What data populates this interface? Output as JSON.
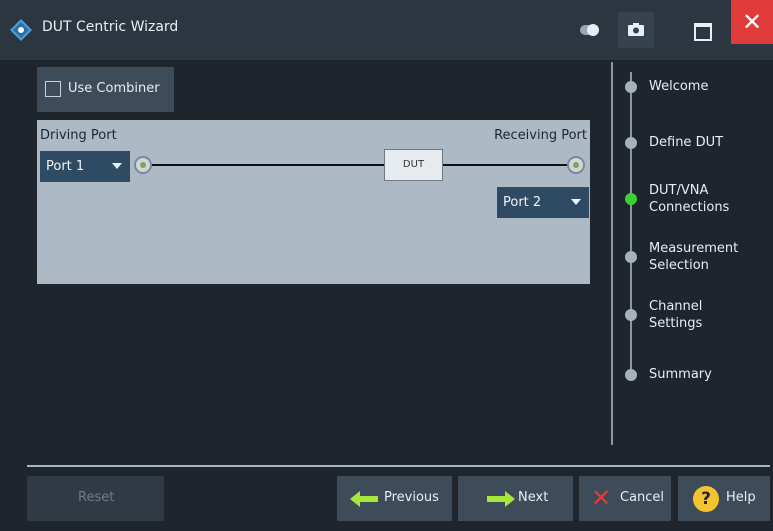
{
  "window": {
    "title": "DUT Centric Wizard",
    "close_glyph": "✕"
  },
  "combiner": {
    "label": "Use Combiner",
    "checked": false
  },
  "diagram": {
    "driving_port_label": "Driving Port",
    "receiving_port_label": "Receiving Port",
    "driving_port_value": "Port 1",
    "receiving_port_value": "Port 2",
    "dut_label": "DUT"
  },
  "steps": [
    {
      "label": "Welcome",
      "active": false
    },
    {
      "label": "Define DUT",
      "active": false
    },
    {
      "label": "DUT/VNA Connections",
      "active": true
    },
    {
      "label": "Measurement Selection",
      "active": false
    },
    {
      "label": "Channel Settings",
      "active": false
    },
    {
      "label": "Summary",
      "active": false
    }
  ],
  "buttons": {
    "reset": "Reset",
    "previous": "Previous",
    "next": "Next",
    "cancel": "Cancel",
    "help": "Help",
    "help_glyph": "?",
    "cancel_glyph": "✕"
  },
  "colors": {
    "accent_active_step": "#3ad131",
    "close_button": "#e13a3a",
    "arrow": "#a5e83a"
  }
}
